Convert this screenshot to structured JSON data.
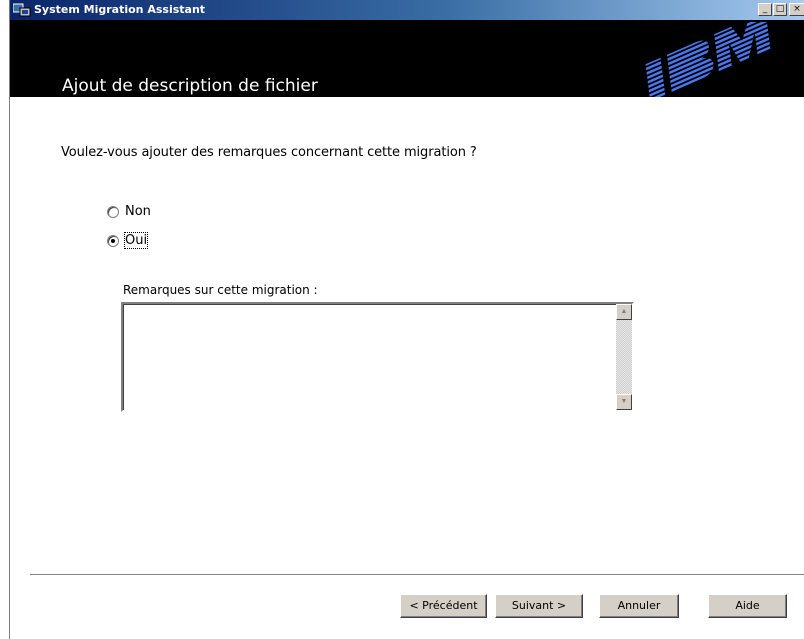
{
  "window": {
    "title": "System Migration Assistant",
    "controls": {
      "minimize": "_",
      "maximize": "□",
      "close": "×"
    }
  },
  "header": {
    "title": "Ajout de description de fichier",
    "logo_text": "IBM"
  },
  "main": {
    "question": "Voulez-vous ajouter des remarques concernant cette migration ?",
    "options": [
      {
        "label": "Non",
        "checked": false
      },
      {
        "label": "Oui",
        "checked": true
      }
    ],
    "notes_label": "Remarques sur cette migration :",
    "notes_value": ""
  },
  "buttons": {
    "back": "< Précédent",
    "next": "Suivant >",
    "cancel": "Annuler",
    "help": "Aide"
  },
  "colors": {
    "header_bg": "#000000",
    "titlebar_start": "#0a246a",
    "button_face": "#d4d0c8",
    "logo_blue": "#3f6cf0"
  }
}
